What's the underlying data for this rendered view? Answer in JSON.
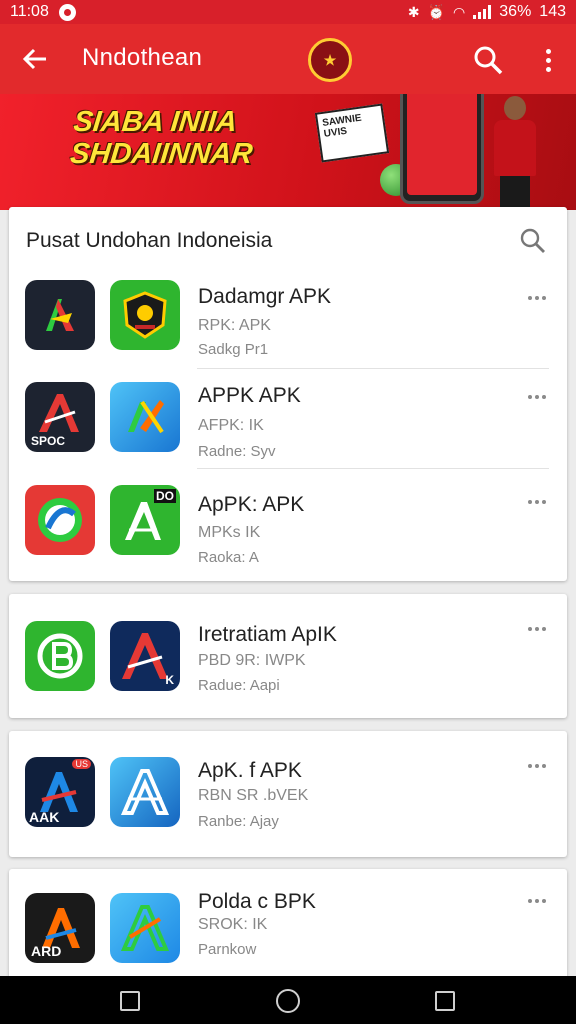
{
  "status_bar": {
    "time": "11:08",
    "battery": "36%",
    "extra": "143"
  },
  "app_bar": {
    "title": "Nndothean"
  },
  "banner": {
    "line1": "SIABA INIIA",
    "line2": "SHDAIINNAR",
    "card_text": "SAWNIE UVIS"
  },
  "colors": {
    "primary": "#e22a2c",
    "statusbar": "#d8202a",
    "banner_text": "#ffe63a"
  },
  "list_card": {
    "title": "Pusat Undohan Indoneisia",
    "items": [
      {
        "title": "Dadamgr APK",
        "line1": "RPK: APK",
        "line2": "Sadkg Pr1"
      },
      {
        "title": "APPK APK",
        "line1": "AFPK: IK",
        "line2": "Radne: Syv"
      },
      {
        "title": "ApPK: APK",
        "line1": "MPKs IK",
        "line2": "Raoka: A"
      }
    ]
  },
  "cards": [
    {
      "title": "Iretratiam ApIK",
      "line1": "PBD 9R: IWPK",
      "line2": "Radue: Aapi"
    },
    {
      "title": "ApK. f APK",
      "line1": "RBN SR .bVEK",
      "line2": "Ranbe: Ajay"
    },
    {
      "title": "Polda c BPK",
      "line1": "SROK: IK",
      "line2": "Parnkow"
    }
  ],
  "icon_labels": {
    "row2_left": "SPOC",
    "row3_right": "DO",
    "card2_right": "K",
    "card3_left": "AAK",
    "card3_left_badge": "US",
    "card4_left": "ARD"
  },
  "icons": [
    "back-arrow-icon",
    "search-icon",
    "more-vert-icon",
    "more-horiz-icon",
    "app-icon",
    "nav-back-icon",
    "nav-home-icon",
    "nav-recents-icon"
  ]
}
